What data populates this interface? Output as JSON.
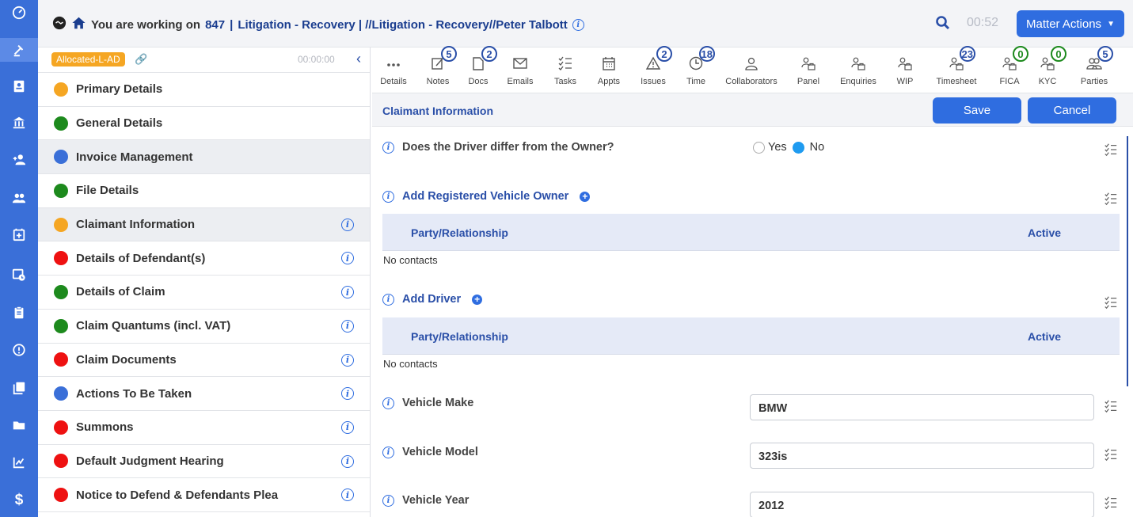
{
  "header": {
    "working_label": "You are working on",
    "matter_number": "847",
    "separator": "|",
    "matter_name": "Litigation - Recovery | //Litigation - Recovery//Peter Talbott",
    "timer": "00:52",
    "matter_actions_label": "Matter Actions"
  },
  "left_panel": {
    "allocated_badge": "Allocated-L-AD",
    "timer": "00:00:00",
    "items": [
      {
        "label": "Primary Details",
        "color": "#f5a623"
      },
      {
        "label": "General Details",
        "color": "#1d8a1d"
      },
      {
        "label": "Invoice Management",
        "color": "#3a6fd8"
      },
      {
        "label": "File Details",
        "color": "#1d8a1d"
      },
      {
        "label": "Claimant Information",
        "color": "#f5a623"
      },
      {
        "label": "Details of Defendant(s)",
        "color": "#ee1111"
      },
      {
        "label": "Details of Claim",
        "color": "#1d8a1d"
      },
      {
        "label": "Claim Quantums (incl. VAT)",
        "color": "#1d8a1d"
      },
      {
        "label": "Claim Documents",
        "color": "#ee1111"
      },
      {
        "label": "Actions To Be Taken",
        "color": "#3a6fd8"
      },
      {
        "label": "Summons",
        "color": "#ee1111"
      },
      {
        "label": "Default Judgment Hearing",
        "color": "#ee1111"
      },
      {
        "label": "Notice to Defend & Defendants Plea",
        "color": "#ee1111"
      }
    ]
  },
  "toolbar": {
    "tools": [
      {
        "label": "Details",
        "icon": "dots-icon",
        "badge": ""
      },
      {
        "label": "Notes",
        "icon": "notes-icon",
        "badge": "5"
      },
      {
        "label": "Docs",
        "icon": "docs-icon",
        "badge": "2"
      },
      {
        "label": "Emails",
        "icon": "email-icon",
        "badge": ""
      },
      {
        "label": "Tasks",
        "icon": "tasks-icon",
        "badge": ""
      },
      {
        "label": "Appts",
        "icon": "calendar-icon",
        "badge": ""
      },
      {
        "label": "Issues",
        "icon": "warning-icon",
        "badge": "2"
      },
      {
        "label": "Time",
        "icon": "clock-icon",
        "badge": "18"
      },
      {
        "label": "Collaborators",
        "icon": "person-icon",
        "badge": ""
      },
      {
        "label": "Panel",
        "icon": "person-briefcase-icon",
        "badge": ""
      },
      {
        "label": "Enquiries",
        "icon": "person-briefcase-icon",
        "badge": ""
      },
      {
        "label": "WIP",
        "icon": "person-briefcase-icon",
        "badge": ""
      },
      {
        "label": "Timesheet",
        "icon": "person-briefcase-icon",
        "badge": "23"
      },
      {
        "label": "FICA",
        "icon": "person-briefcase-icon",
        "badge": "0"
      },
      {
        "label": "KYC",
        "icon": "person-briefcase-icon",
        "badge": "0"
      },
      {
        "label": "Parties",
        "icon": "people-icon",
        "badge": "5"
      }
    ]
  },
  "content": {
    "section_title": "Claimant Information",
    "save_label": "Save",
    "cancel_label": "Cancel",
    "driver_question": "Does the Driver differ from the Owner?",
    "yes_label": "Yes",
    "no_label": "No",
    "add_owner_label": "Add Registered Vehicle Owner",
    "add_driver_label": "Add Driver",
    "col_party": "Party/Relationship",
    "col_active": "Active",
    "no_contacts": "No contacts",
    "vehicle_make_label": "Vehicle Make",
    "vehicle_make_value": "BMW",
    "vehicle_model_label": "Vehicle Model",
    "vehicle_model_value": "323is",
    "vehicle_year_label": "Vehicle Year",
    "vehicle_year_value": "2012"
  }
}
